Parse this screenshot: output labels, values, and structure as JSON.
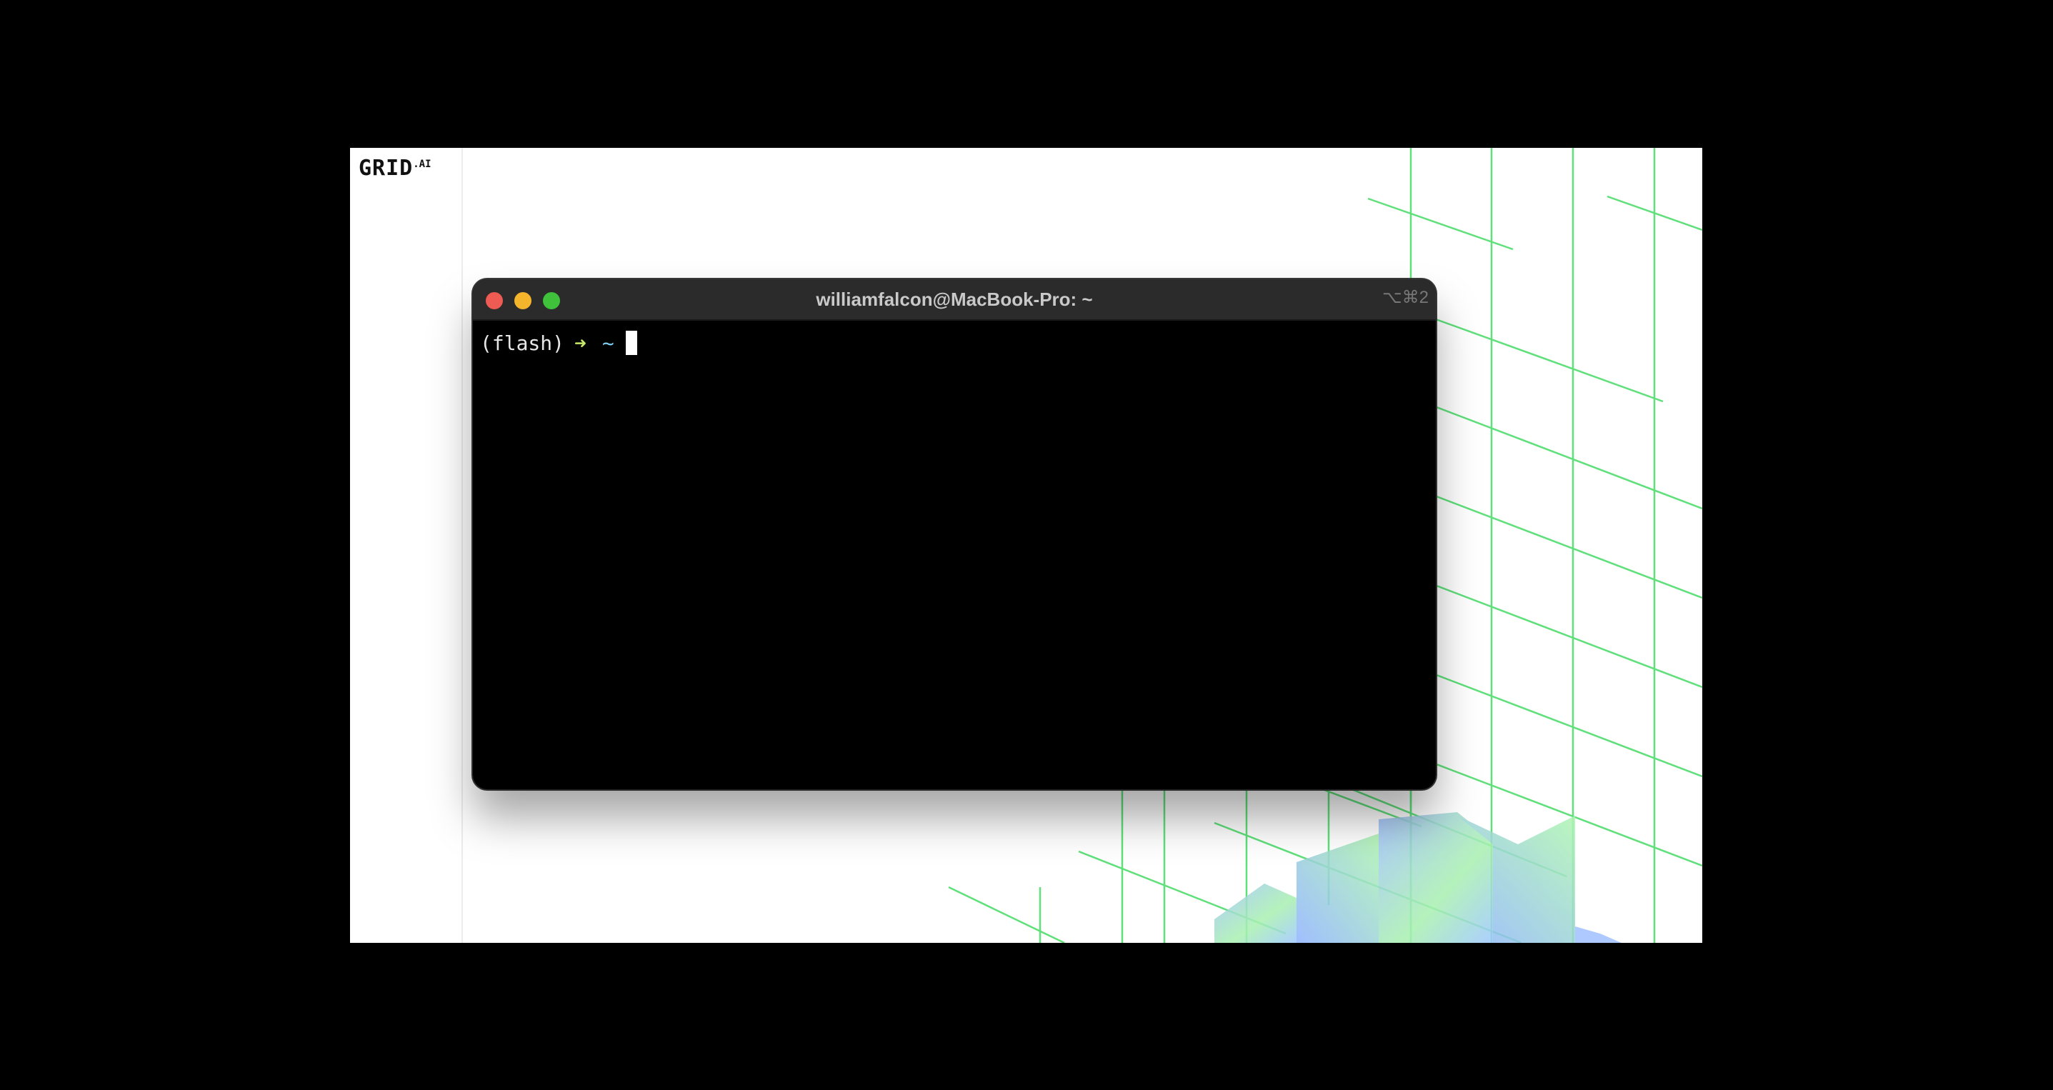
{
  "brand": {
    "logo_main": "GRID",
    "logo_sup": ".AI"
  },
  "terminal": {
    "title": "williamfalcon@MacBook-Pro: ~",
    "shortcut": "⌥⌘2",
    "prompt_env": "(flash)",
    "prompt_arrow": "➜",
    "prompt_dir": "~"
  },
  "colors": {
    "grid_line": "#5fe07a",
    "accent_green": "#c7e86b",
    "accent_blue": "#7ecff5",
    "close": "#ee5b52",
    "minimize": "#f4b52c",
    "maximize": "#3fc13c"
  }
}
